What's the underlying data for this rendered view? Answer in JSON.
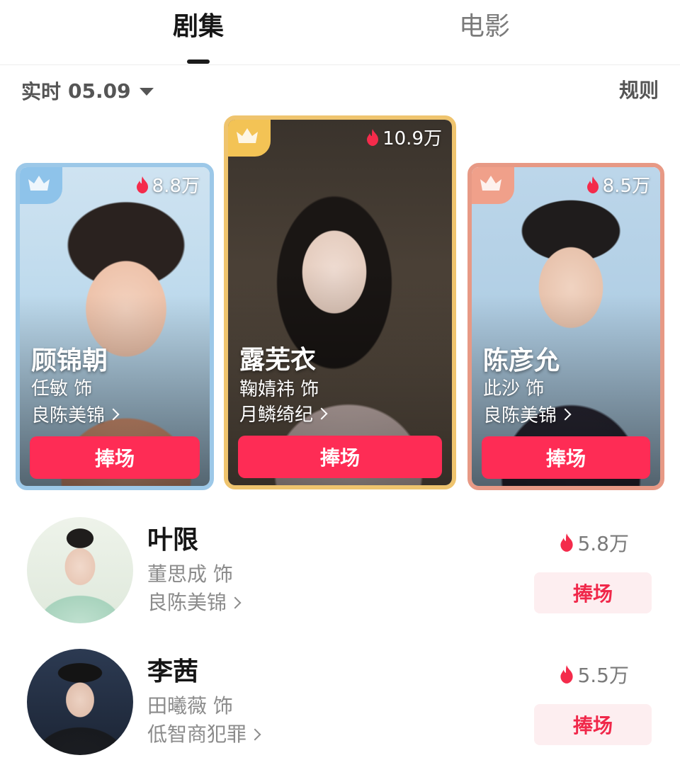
{
  "tabs": {
    "series": "剧集",
    "movie": "电影"
  },
  "filter": {
    "label": "实时",
    "date": "05.09",
    "rules": "规则"
  },
  "podium": [
    {
      "rank": 2,
      "heat": "8.8万",
      "name": "顾锦朝",
      "role": "任敏 饰",
      "show": "良陈美锦",
      "button": "捧场",
      "accent": "#9cc8e8"
    },
    {
      "rank": 1,
      "heat": "10.9万",
      "name": "露芜衣",
      "role": "鞠婧祎 饰",
      "show": "月鳞绮纪",
      "button": "捧场",
      "accent": "#efc46e"
    },
    {
      "rank": 3,
      "heat": "8.5万",
      "name": "陈彦允",
      "role": "此沙 饰",
      "show": "良陈美锦",
      "button": "捧场",
      "accent": "#e79985"
    }
  ],
  "list": [
    {
      "name": "叶限",
      "role": "董思成 饰",
      "show": "良陈美锦",
      "heat": "5.8万",
      "button": "捧场"
    },
    {
      "name": "李茜",
      "role": "田曦薇 饰",
      "show": "低智商犯罪",
      "heat": "5.5万",
      "button": "捧场"
    }
  ],
  "colors": {
    "primary_button": "#fe2c55",
    "soft_button": "#fdeef0",
    "flame": "#f42b4b"
  },
  "icons": {
    "crown": "crown-icon",
    "flame": "flame-icon",
    "caret": "caret-down-icon",
    "chevron": "chevron-right-icon"
  }
}
